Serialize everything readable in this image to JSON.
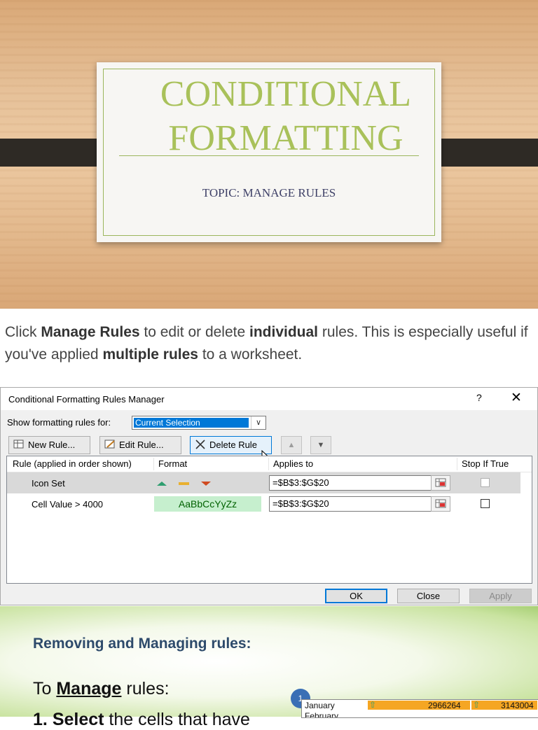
{
  "slide1": {
    "title_line1": "CONDITIONAL",
    "title_line2": "FORMATTING",
    "subtitle": "TOPIC: MANAGE RULES"
  },
  "paragraph": {
    "p1": "Click ",
    "b1": "Manage Rules",
    "p2": " to edit or delete ",
    "b2": "individual",
    "p3": " rules. This is especially useful if you've applied ",
    "b3": "multiple rules",
    "p4": " to a worksheet."
  },
  "dialog": {
    "title": "Conditional Formatting Rules Manager",
    "help": "?",
    "close": "✕",
    "show_label": "Show formatting rules for:",
    "show_value": "Current Selection",
    "buttons": {
      "new_rule": "New Rule...",
      "edit_rule": "Edit Rule...",
      "delete_rule": "Delete Rule"
    },
    "columns": {
      "rule": "Rule (applied in order shown)",
      "format": "Format",
      "applies": "Applies to",
      "stop": "Stop If True"
    },
    "rows": [
      {
        "rule": "Icon Set",
        "format": "",
        "applies": "=$B$3:$G$20",
        "stop_if_true": false,
        "selected": true
      },
      {
        "rule": "Cell Value > 4000",
        "format": "AaBbCcYyZz",
        "applies": "=$B$3:$G$20",
        "stop_if_true": false,
        "selected": false
      }
    ],
    "footer": {
      "ok": "OK",
      "close": "Close",
      "apply": "Apply"
    }
  },
  "slide3": {
    "heading": "Removing and Managing rules:",
    "to": "To ",
    "manage": "Manage",
    "rules": " rules:",
    "step_num": "1.",
    "select": "Select",
    "select_rest": " the cells that have",
    "badge": "1",
    "table": {
      "month1": "January",
      "month2": "February",
      "val1": "2966264",
      "val2": "3143004"
    }
  },
  "colors": {
    "slide_title": "#a9c15a",
    "subtitle": "#3d3f66",
    "selection_blue": "#0078d7",
    "format_green_fill": "#c6efce",
    "format_green_text": "#006100",
    "heading_blue": "#2d4a6b"
  }
}
